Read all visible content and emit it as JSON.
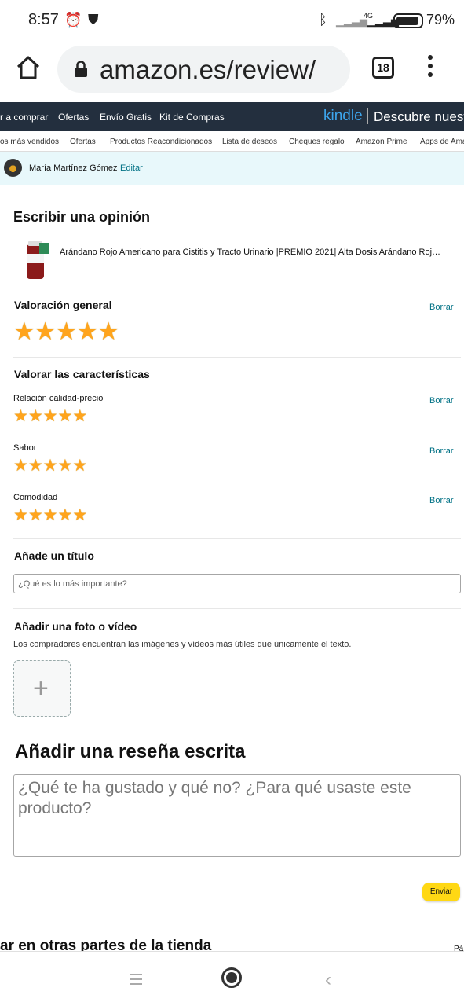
{
  "status": {
    "time": "8:57",
    "battery": "79%",
    "network": "4G"
  },
  "browser": {
    "url": "amazon.es/review/",
    "tab_count": "18"
  },
  "nav_primary": [
    "r a comprar",
    "Ofertas",
    "Envío Gratis",
    "Kit de Compras"
  ],
  "nav_kindle": {
    "brand": "kindle",
    "text": "Descubre nuest"
  },
  "nav_secondary": [
    "os más vendidos",
    "Ofertas",
    "Productos Reacondicionados",
    "Lista de deseos",
    "Cheques regalo",
    "Amazon Prime",
    "Apps de Ama"
  ],
  "user": {
    "name": "María Martínez Gómez",
    "edit": "Editar"
  },
  "page": {
    "title": "Escribir una opinión",
    "product_title": "Arándano Rojo Americano para Cistitis y Tracto Urinario |PREMIO 2021| Alta Dosis Arándano Roj…",
    "overall": {
      "label": "Valoración general",
      "clear": "Borrar",
      "rating": 5
    },
    "features_title": "Valorar las características",
    "features": [
      {
        "label": "Relación calidad-precio",
        "clear": "Borrar",
        "rating": 5
      },
      {
        "label": "Sabor",
        "clear": "Borrar",
        "rating": 5
      },
      {
        "label": "Comodidad",
        "clear": "Borrar",
        "rating": 5
      }
    ],
    "title_section": {
      "label": "Añade un título",
      "placeholder": "¿Qué es lo más importante?"
    },
    "photo_section": {
      "label": "Añadir una foto o vídeo",
      "description": "Los compradores encuentran las imágenes y vídeos más útiles que únicamente el texto."
    },
    "review_section": {
      "label": "Añadir una reseña escrita",
      "placeholder": "¿Qué te ha gustado y qué no? ¿Para qué usaste este producto?"
    },
    "submit": "Enviar",
    "footer": "ar en otras partes de la tienda",
    "footer_right": "Pá"
  },
  "colors": {
    "accent": "#007185",
    "star": "#ffa41c",
    "button": "#ffd814",
    "nav_bg": "#232f3e",
    "user_bg": "#e8f8fb"
  }
}
